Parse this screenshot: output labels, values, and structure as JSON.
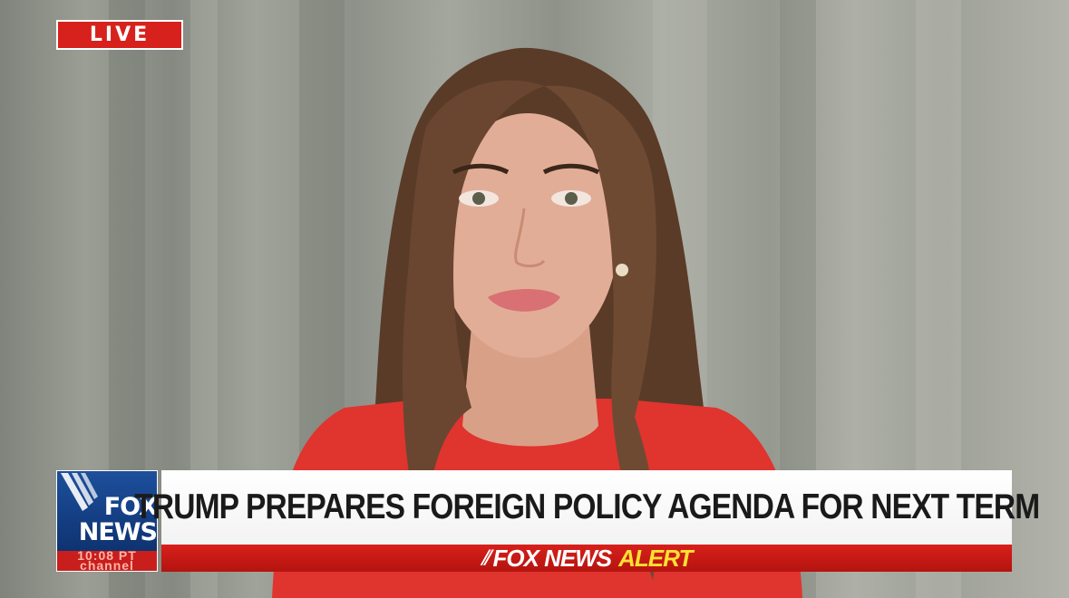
{
  "badge": {
    "live_label": "LIVE"
  },
  "logo": {
    "line1": "FOX",
    "line2": "NEWS",
    "clock_line1": "10:08 PT",
    "clock_line2": "channel"
  },
  "chyron": {
    "headline": "TRUMP PREPARES FOREIGN POLICY AGENDA FOR NEXT TERM",
    "alert_brand": "FOX NEWS",
    "alert_word": "ALERT"
  },
  "colors": {
    "live_red": "#d6211c",
    "logo_blue": "#1d4f9c",
    "alert_red": "#c81a15",
    "alert_yellow": "#ffe033",
    "headline_bg": "#ffffff"
  },
  "icons": {
    "logo_mark": "fox-news-stripes-icon",
    "alert_mark": "fox-stripes-icon"
  }
}
